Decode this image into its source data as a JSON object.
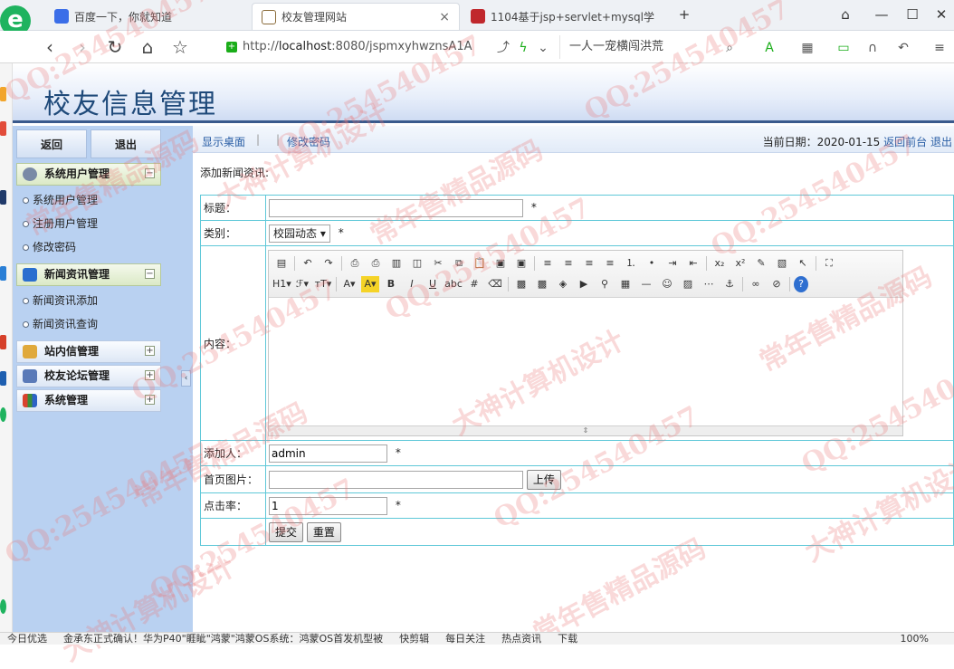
{
  "browser": {
    "logo": "e",
    "tabs": [
      {
        "title": "百度一下，你就知道",
        "active": false
      },
      {
        "title": "校友管理网站",
        "active": true
      },
      {
        "title": "1104基于jsp+servlet+mysql学",
        "active": false
      }
    ],
    "url_prefix": "http://",
    "url_host": "localhost",
    "url_rest": ":8080/jspmxyhwznsA1A",
    "search_text": "一人一宠横闯洪荒"
  },
  "app": {
    "title": "校友信息管理"
  },
  "sidebar": {
    "top_buttons": [
      "返回",
      "退出"
    ],
    "groups": [
      {
        "label": "系统用户管理",
        "expanded": true,
        "items": [
          "系统用户管理",
          "注册用户管理",
          "修改密码"
        ]
      },
      {
        "label": "新闻资讯管理",
        "expanded": true,
        "items": [
          "新闻资讯添加",
          "新闻资讯查询"
        ]
      },
      {
        "label": "站内信管理",
        "expanded": false,
        "items": []
      },
      {
        "label": "校友论坛管理",
        "expanded": false,
        "items": []
      },
      {
        "label": "系统管理",
        "expanded": false,
        "items": []
      }
    ]
  },
  "topbar": {
    "links": [
      "显示桌面",
      "修改密码"
    ],
    "date_label": "当前日期：2020-01-15",
    "back_front": "返回前台",
    "logout": "退出"
  },
  "form": {
    "heading": "添加新闻资讯:",
    "title_label": "标题：",
    "title_value": "",
    "category_label": "类别：",
    "category_value": "校园动态",
    "content_label": "内容：",
    "author_label": "添加人：",
    "author_value": "admin",
    "image_label": "首页图片：",
    "upload_button": "上传",
    "clicks_label": "点击率：",
    "clicks_value": "1",
    "required_mark": "*",
    "submit_button": "提交",
    "reset_button": "重置"
  },
  "editor_toolbar": {
    "row1": [
      "source",
      "undo",
      "redo",
      "preview",
      "print",
      "template",
      "code",
      "cut",
      "copy",
      "paste",
      "paste-text",
      "paste-word",
      "align-left",
      "align-center",
      "align-right",
      "justify",
      "ordered-list",
      "unordered-list",
      "indent",
      "outdent",
      "subscript",
      "superscript",
      "clear-format",
      "select-all",
      "cursor",
      "fullscreen"
    ],
    "row2": [
      "H1",
      "F",
      "TT",
      "A",
      "A",
      "B",
      "I",
      "U",
      "ABC",
      "hr",
      "eraser",
      "image",
      "multi-image",
      "flash",
      "media",
      "attachment",
      "table",
      "hr-line",
      "emoticon",
      "map",
      "page-break",
      "anchor",
      "link",
      "unlink",
      "help"
    ]
  },
  "watermarks": [
    "QQ:254540457",
    "常年售精品源码",
    "大神计算机设计"
  ],
  "statusbar": {
    "items": [
      "今日优选",
      "金承东正式确认！华为P40\"睚眦\"鸿蒙\"鸿蒙OS系统：鸿蒙OS首发机型被",
      "快剪辑",
      "每日关注",
      "热点资讯",
      "下载",
      "100%"
    ]
  }
}
